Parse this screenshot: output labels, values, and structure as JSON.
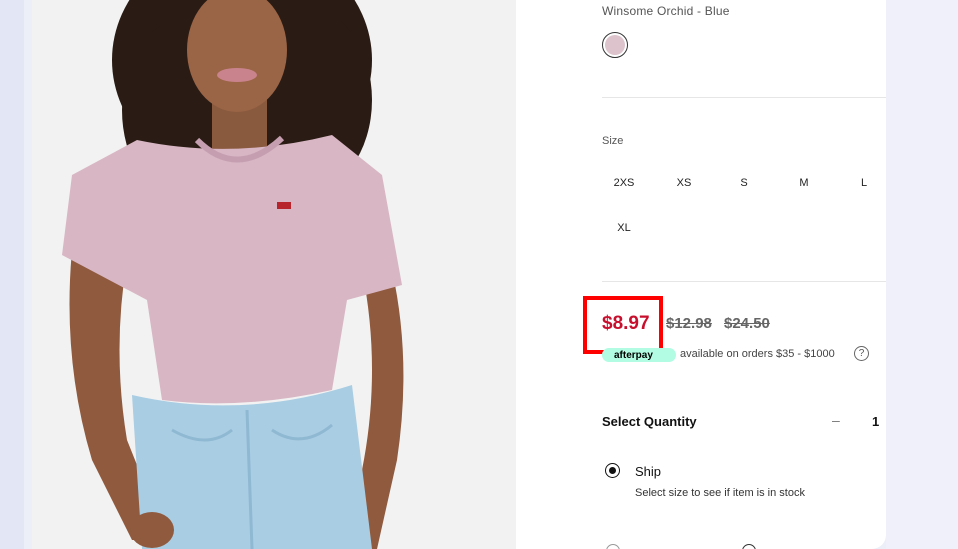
{
  "product": {
    "color_name": "Winsome Orchid - Blue",
    "selected_color": "#dcc3cc"
  },
  "size": {
    "title": "Size",
    "options": [
      "2XS",
      "XS",
      "S",
      "M",
      "L",
      "XL"
    ]
  },
  "price": {
    "sale": "$8.97",
    "original_1": "$12.98",
    "original_2": "$24.50",
    "sale_color": "#c8102e"
  },
  "afterpay": {
    "logo_text": "afterpay",
    "text": "available on orders $35 - $1000",
    "help": "?"
  },
  "quantity": {
    "label": "Select Quantity",
    "minus": "–",
    "value": "1"
  },
  "fulfillment": {
    "ship_label": "Ship",
    "ship_note": "Select size to see if item is in stock"
  }
}
